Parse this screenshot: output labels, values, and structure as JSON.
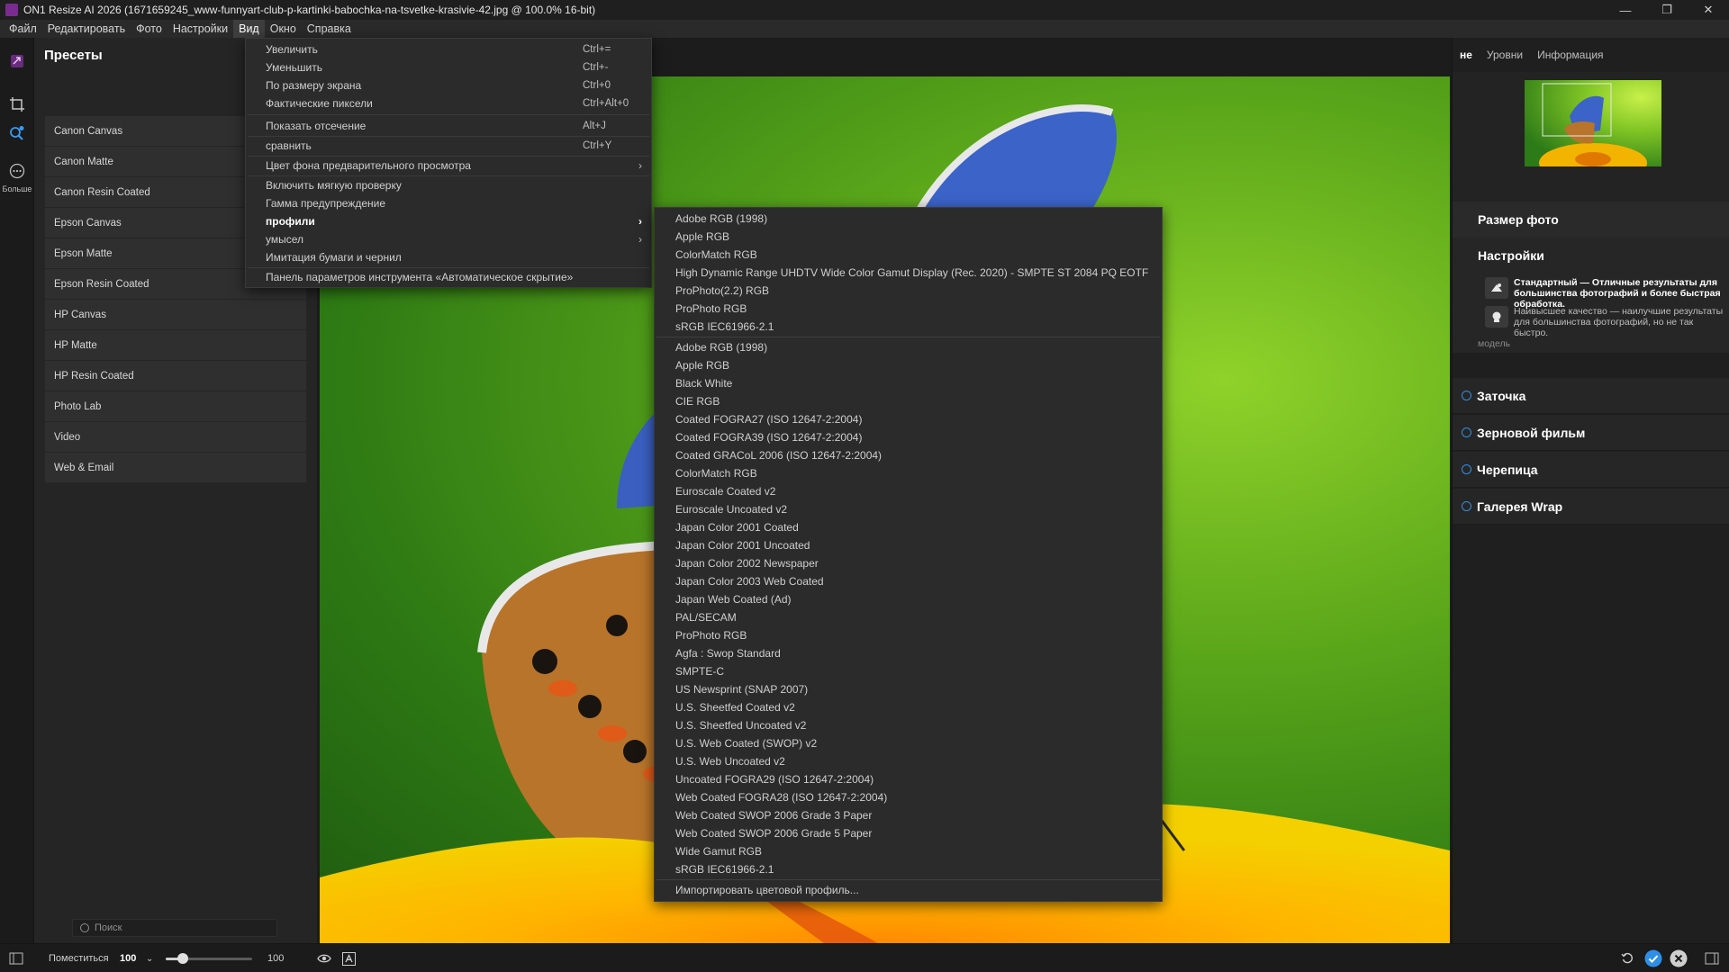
{
  "window": {
    "title": "ON1 Resize AI 2026 (1671659245_www-funnyart-club-p-kartinki-babochka-na-tsvetke-krasivie-42.jpg @ 100.0% 16-bit)"
  },
  "menubar": {
    "items": [
      "Файл",
      "Редактировать",
      "Фото",
      "Настройки",
      "Вид",
      "Окно",
      "Справка"
    ],
    "active": "Вид"
  },
  "toolstrip": {
    "more_label": "Больше"
  },
  "presets": {
    "title": "Пресеты",
    "items": [
      "Canon Canvas",
      "Canon Matte",
      "Canon Resin Coated",
      "Epson Canvas",
      "Epson Matte",
      "Epson Resin Coated",
      "HP Canvas",
      "HP Matte",
      "HP Resin Coated",
      "Photo Lab",
      "Video",
      "Web & Email"
    ],
    "search_placeholder": "Поиск"
  },
  "view_menu": {
    "items": [
      {
        "label": "Увеличить",
        "shortcut": "Ctrl+="
      },
      {
        "label": "Уменьшить",
        "shortcut": "Ctrl+-"
      },
      {
        "label": "По размеру экрана",
        "shortcut": "Ctrl+0"
      },
      {
        "label": "Фактические пиксели",
        "shortcut": "Ctrl+Alt+0"
      },
      {
        "label": "Показать отсечение",
        "shortcut": "Alt+J"
      },
      {
        "label": "сравнить",
        "shortcut": "Ctrl+Y"
      },
      {
        "label": "Цвет фона предварительного просмотра",
        "shortcut": ""
      },
      {
        "label": "Включить мягкую проверку",
        "shortcut": ""
      },
      {
        "label": "Гамма предупреждение",
        "shortcut": ""
      },
      {
        "label": "профили",
        "shortcut": ""
      },
      {
        "label": "умысел",
        "shortcut": ""
      },
      {
        "label": "Имитация бумаги и чернил",
        "shortcut": ""
      },
      {
        "label": "Панель параметров инструмента «Автоматическое скрытие»",
        "shortcut": ""
      }
    ]
  },
  "profile_menu": {
    "group1": [
      "Adobe RGB (1998)",
      "Apple RGB",
      "ColorMatch RGB",
      "High Dynamic Range UHDTV Wide Color Gamut Display (Rec. 2020) - SMPTE ST 2084 PQ EOTF",
      "ProPhoto(2.2) RGB",
      "ProPhoto RGB",
      "sRGB IEC61966-2.1"
    ],
    "checked": "sRGB IEC61966-2.1",
    "group2": [
      "Adobe RGB (1998)",
      "Apple RGB",
      "Black  White",
      "CIE RGB",
      "Coated FOGRA27 (ISO 12647-2:2004)",
      "Coated FOGRA39 (ISO 12647-2:2004)",
      "Coated GRACoL 2006 (ISO 12647-2:2004)",
      "ColorMatch RGB",
      "Euroscale Coated v2",
      "Euroscale Uncoated v2",
      "Japan Color 2001 Coated",
      "Japan Color 2001 Uncoated",
      "Japan Color 2002 Newspaper",
      "Japan Color 2003 Web Coated",
      "Japan Web Coated (Ad)",
      "PAL/SECAM",
      "ProPhoto RGB",
      "Agfa : Swop Standard",
      "SMPTE-C",
      "US Newsprint (SNAP 2007)",
      "U.S. Sheetfed Coated v2",
      "U.S. Sheetfed Uncoated v2",
      "U.S. Web Coated (SWOP) v2",
      "U.S. Web Uncoated v2",
      "Uncoated FOGRA29 (ISO 12647-2:2004)",
      "Web Coated FOGRA28 (ISO 12647-2:2004)",
      "Web Coated SWOP 2006 Grade 3 Paper",
      "Web Coated SWOP 2006 Grade 5 Paper",
      "Wide Gamut RGB",
      "sRGB IEC61966-2.1"
    ],
    "import_label": "Импортировать цветовой профиль..."
  },
  "right_panel": {
    "tabs": [
      "не",
      "Уровни",
      "Информация"
    ],
    "photo_size_title": "Размер фото",
    "settings_title": "Настройки",
    "standard_option": "Стандартный — Отличные результаты для большинства фотографий и более быстрая обработка.",
    "highest_option": "Наивысшее качество — наилучшие результаты для большинства фотографий, но не так быстро.",
    "model_label": "модель",
    "sections": [
      "Заточка",
      "Зерновой фильм",
      "Черепица",
      "Галерея Wrap"
    ]
  },
  "bottombar": {
    "fit_label": "Поместиться",
    "zoom_value": "100",
    "slider_value": 0.2,
    "slider_max_label": "100"
  },
  "colors": {
    "accent": "#2f8fe6",
    "app_icon": "#7a2b8f"
  }
}
